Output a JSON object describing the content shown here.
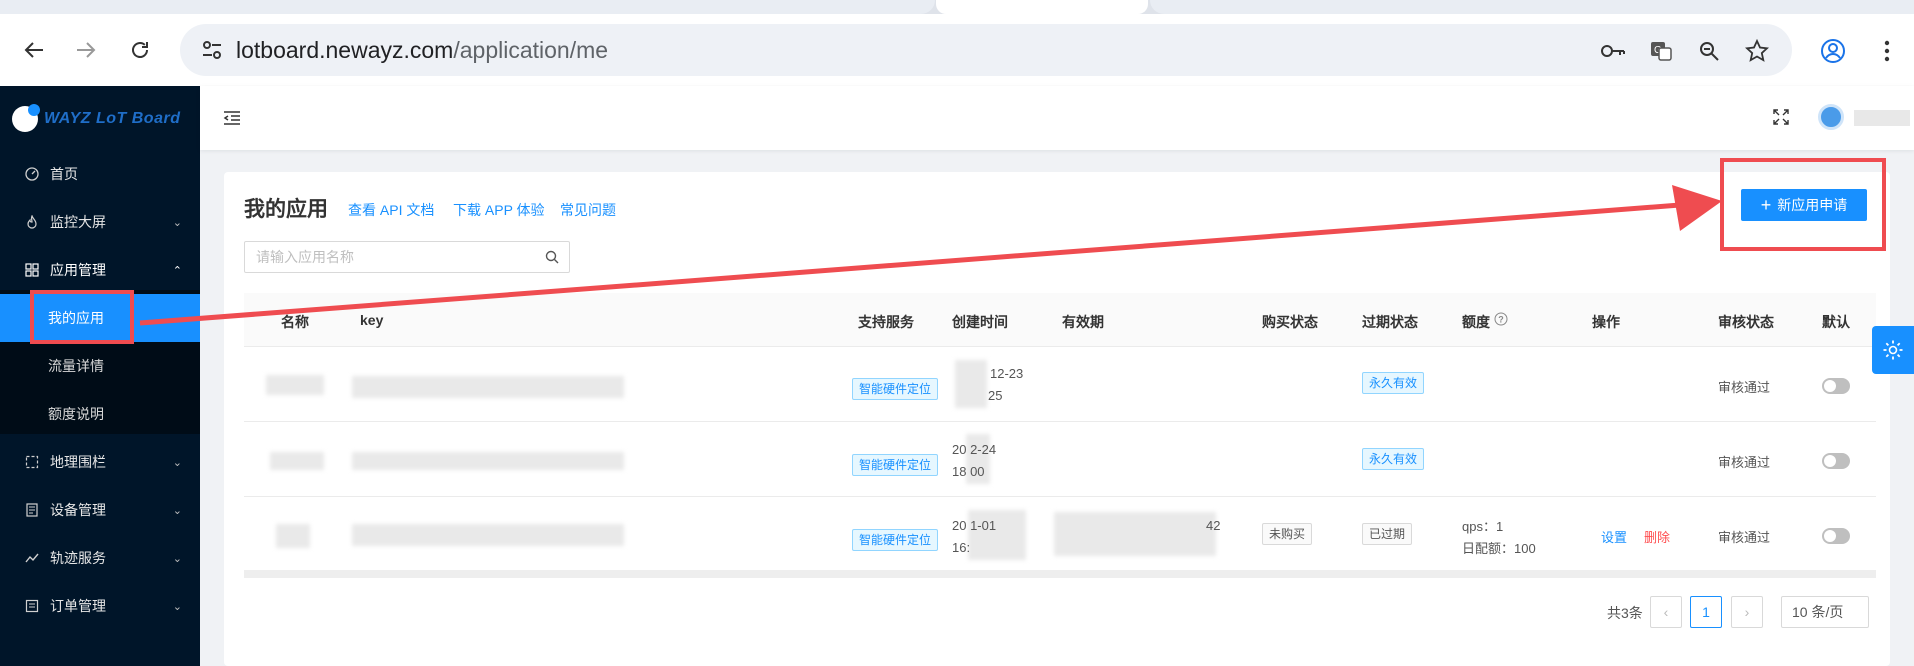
{
  "browser": {
    "url_host": "lotboard.newayz.com",
    "url_path": "/application/me"
  },
  "sidebar": {
    "logo_text": "WAYZ LoT Board",
    "items": [
      {
        "label": "首页",
        "icon": "dashboard-icon"
      },
      {
        "label": "监控大屏",
        "icon": "fire-icon"
      },
      {
        "label": "应用管理",
        "icon": "apps-icon"
      },
      {
        "label": "地理围栏",
        "icon": "fence-icon"
      },
      {
        "label": "设备管理",
        "icon": "device-icon"
      },
      {
        "label": "轨迹服务",
        "icon": "track-icon"
      },
      {
        "label": "订单管理",
        "icon": "order-icon"
      }
    ],
    "sub_items": [
      {
        "label": "我的应用"
      },
      {
        "label": "流量详情"
      },
      {
        "label": "额度说明"
      }
    ]
  },
  "page": {
    "title": "我的应用",
    "links": [
      "查看 API 文档",
      "下载 APP 体验",
      "常见问题"
    ],
    "new_button": "新应用申请",
    "search_placeholder": "请输入应用名称"
  },
  "table": {
    "columns": [
      "名称",
      "key",
      "支持服务",
      "创建时间",
      "有效期",
      "购买状态",
      "过期状态",
      "额度",
      "操作",
      "审核状态",
      "默认"
    ],
    "rows": [
      {
        "service": "智能硬件定位",
        "created_line1": "12-23",
        "created_line2": "25",
        "validity": "",
        "buy_status": "",
        "expire_status": "永久有效",
        "quota_line1": "",
        "quota_line2": "",
        "action_set": "",
        "action_del": "",
        "review": "审核通过"
      },
      {
        "service": "智能硬件定位",
        "created_line1": "20 2-24",
        "created_line2": "18 00",
        "validity": "",
        "buy_status": "",
        "expire_status": "永久有效",
        "quota_line1": "",
        "quota_line2": "",
        "action_set": "",
        "action_del": "",
        "review": "审核通过"
      },
      {
        "service": "智能硬件定位",
        "created_line1": "20 1-01",
        "created_line2": "16:",
        "validity": "42",
        "buy_status": "未购买",
        "expire_status": "已过期",
        "quota_line1": "qps：1",
        "quota_line2": "日配额：100",
        "action_set": "设置",
        "action_del": "删除",
        "review": "审核通过"
      }
    ]
  },
  "pagination": {
    "total": "共3条",
    "current": "1",
    "page_size": "10 条/页"
  },
  "colors": {
    "primary": "#1890ff",
    "sidebar_bg": "#001529",
    "annotation_red": "#ef4c50"
  }
}
